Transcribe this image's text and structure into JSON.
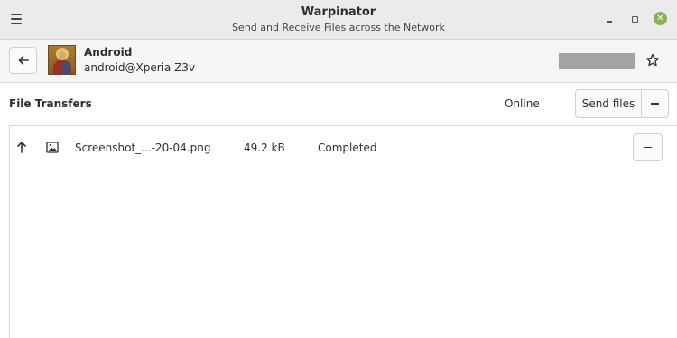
{
  "window": {
    "title": "Warpinator",
    "subtitle": "Send and Receive Files across the Network",
    "accent_close": "#8bb158"
  },
  "icons": {
    "menu": "hamburger-menu-icon",
    "minimize": "minimize-icon",
    "maximize": "maximize-icon",
    "close": "close-icon",
    "back": "arrow-left-icon",
    "favorite": "star-outline-icon",
    "upload": "arrow-up-icon",
    "file": "image-file-icon",
    "more": "minus-icon",
    "cancel": "minus-icon"
  },
  "remote": {
    "name": "Android",
    "user_host": "android@Xperia Z3v"
  },
  "transfers": {
    "section_label": "File Transfers",
    "status": "Online",
    "send_button_label": "Send files",
    "items": [
      {
        "direction": "outgoing",
        "file_name": "Screenshot_...-20-04.png",
        "size": "49.2 kB",
        "status": "Completed"
      }
    ]
  }
}
